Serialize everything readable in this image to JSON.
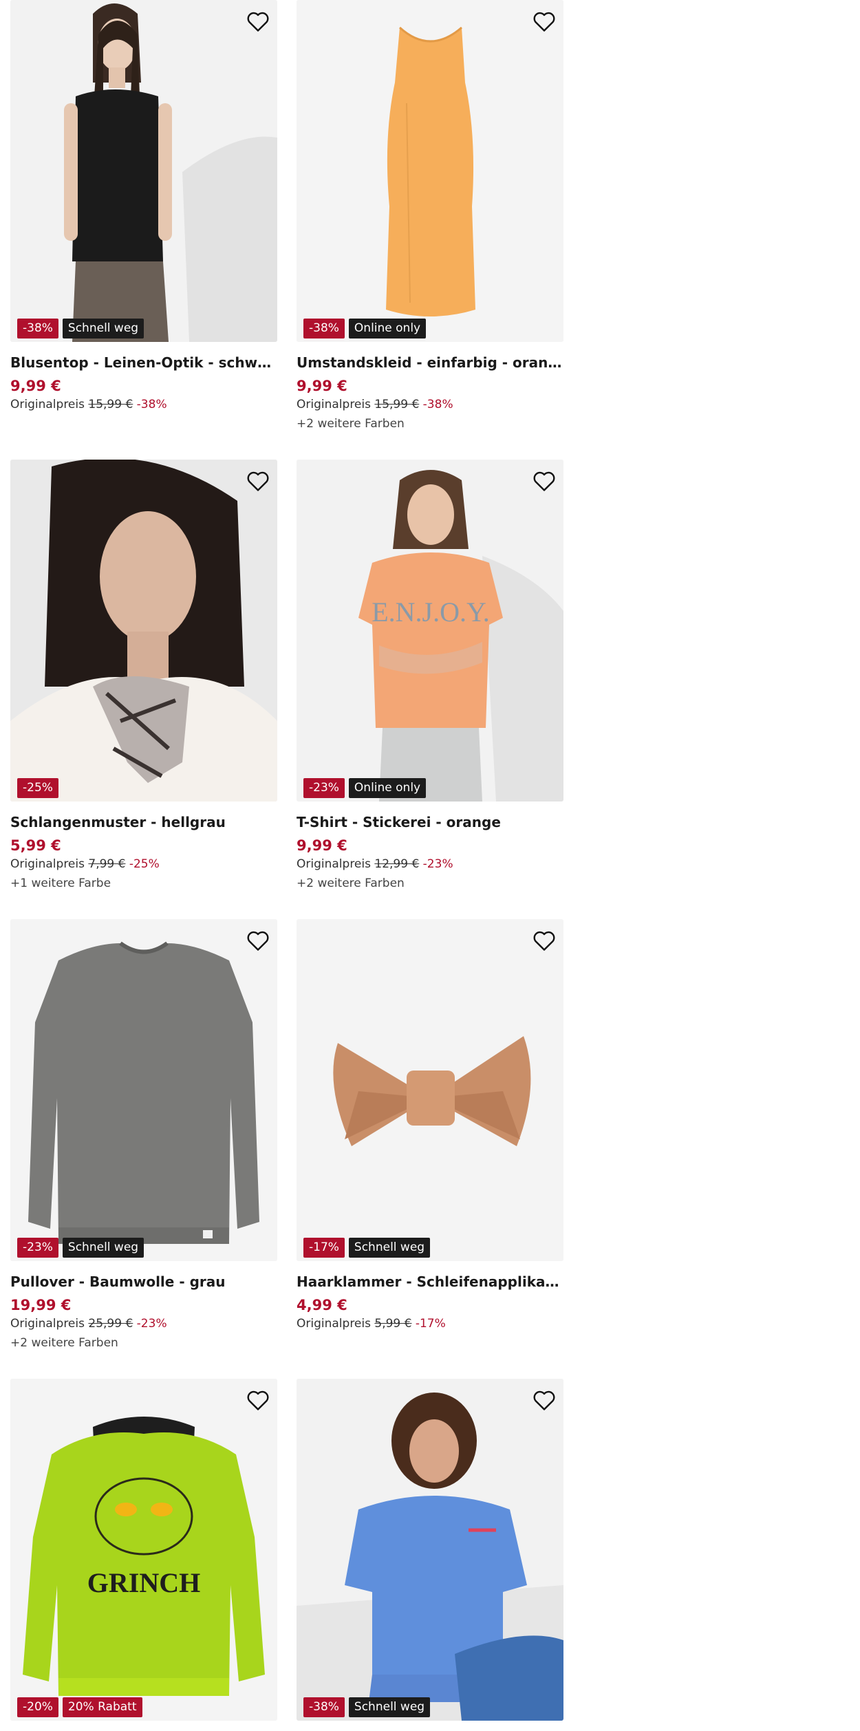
{
  "products": [
    {
      "name": "Blusentop - Leinen-Optik - schwarz",
      "price": "9,99 €",
      "original_label": "Originalpreis",
      "original_price": "15,99 €",
      "discount": "-38%",
      "badges": [
        "-38%",
        "Schnell weg"
      ],
      "more_colors": "",
      "image": "woman-black-blouse"
    },
    {
      "name": "Umstandskleid - einfarbig - orange",
      "price": "9,99 €",
      "original_label": "Originalpreis",
      "original_price": "15,99 €",
      "discount": "-38%",
      "badges": [
        "-38%",
        "Online only"
      ],
      "more_colors": "+2 weitere Farben",
      "image": "orange-dress"
    },
    {
      "name": "Schlangenmuster - hellgrau",
      "price": "5,99 €",
      "original_label": "Originalpreis",
      "original_price": "7,99 €",
      "discount": "-25%",
      "badges": [
        "-25%"
      ],
      "more_colors": "+1 weitere Farbe",
      "image": "woman-snake-scarf"
    },
    {
      "name": "T-Shirt - Stickerei - orange",
      "price": "9,99 €",
      "original_label": "Originalpreis",
      "original_price": "12,99 €",
      "discount": "-23%",
      "badges": [
        "-23%",
        "Online only"
      ],
      "more_colors": "+2 weitere Farben",
      "image": "woman-orange-tshirt",
      "image_text": "E.N.J.O.Y."
    },
    {
      "name": "Pullover - Baumwolle - grau",
      "price": "19,99 €",
      "original_label": "Originalpreis",
      "original_price": "25,99 €",
      "discount": "-23%",
      "badges": [
        "-23%",
        "Schnell weg"
      ],
      "more_colors": "+2 weitere Farben",
      "image": "grey-sweater"
    },
    {
      "name": "Haarklammer - Schleifenapplikation - bra...",
      "price": "4,99 €",
      "original_label": "Originalpreis",
      "original_price": "5,99 €",
      "discount": "-17%",
      "badges": [
        "-17%",
        "Schnell weg"
      ],
      "more_colors": "",
      "image": "hair-bow-clip"
    },
    {
      "name": "",
      "price": "",
      "original_label": "",
      "original_price": "",
      "discount": "",
      "badges": [
        "-20%",
        "20% Rabatt"
      ],
      "more_colors": "",
      "image": "grinch-hoodie",
      "image_text": "GRINCH"
    },
    {
      "name": "",
      "price": "",
      "original_label": "",
      "original_price": "",
      "discount": "",
      "badges": [
        "-38%",
        "Schnell weg"
      ],
      "more_colors": "",
      "image": "woman-blue-tshirt"
    }
  ],
  "icons": {
    "favorite": "heart-outline-icon"
  },
  "colors": {
    "sale": "#b0102d",
    "tag": "#1c1c1c",
    "image_bg": "#f3f3f3"
  }
}
